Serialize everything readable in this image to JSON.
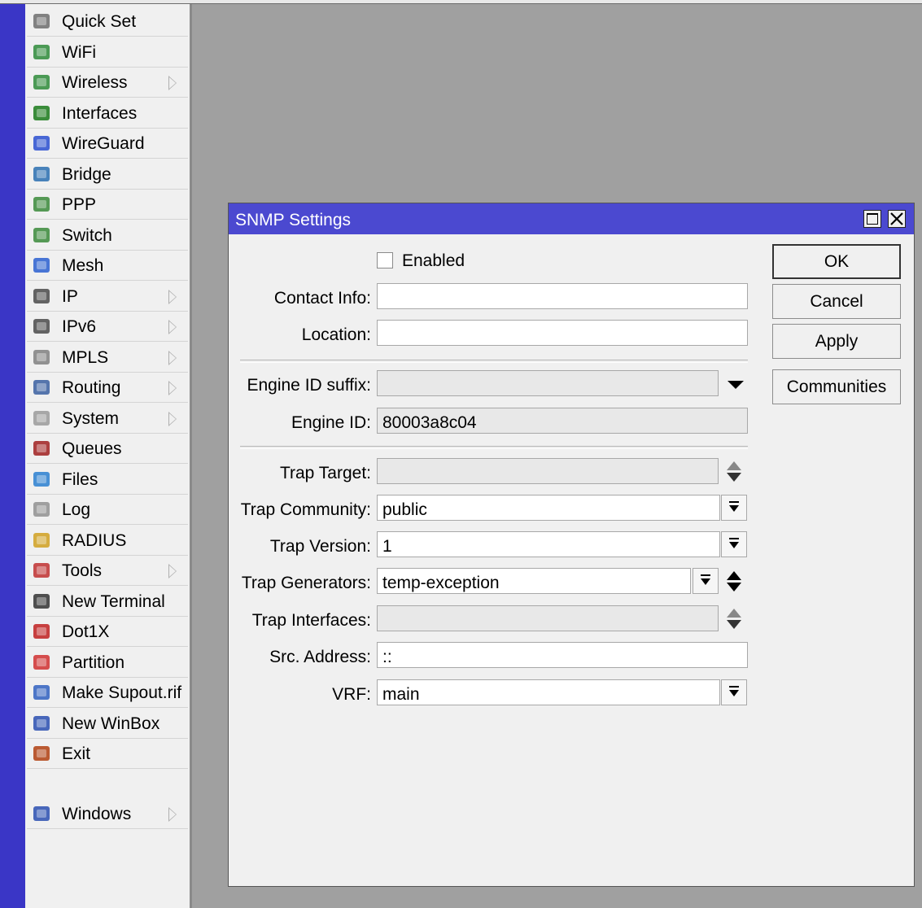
{
  "sidebar": {
    "items": [
      {
        "label": "Quick Set",
        "icon": "quick-set-icon",
        "submenu": false
      },
      {
        "label": "WiFi",
        "icon": "wifi-icon",
        "submenu": false
      },
      {
        "label": "Wireless",
        "icon": "wireless-icon",
        "submenu": true
      },
      {
        "label": "Interfaces",
        "icon": "interfaces-icon",
        "submenu": false
      },
      {
        "label": "WireGuard",
        "icon": "wireguard-icon",
        "submenu": false
      },
      {
        "label": "Bridge",
        "icon": "bridge-icon",
        "submenu": false
      },
      {
        "label": "PPP",
        "icon": "ppp-icon",
        "submenu": false
      },
      {
        "label": "Switch",
        "icon": "switch-icon",
        "submenu": false
      },
      {
        "label": "Mesh",
        "icon": "mesh-icon",
        "submenu": false
      },
      {
        "label": "IP",
        "icon": "ip-icon",
        "submenu": true
      },
      {
        "label": "IPv6",
        "icon": "ipv6-icon",
        "submenu": true
      },
      {
        "label": "MPLS",
        "icon": "mpls-icon",
        "submenu": true
      },
      {
        "label": "Routing",
        "icon": "routing-icon",
        "submenu": true
      },
      {
        "label": "System",
        "icon": "system-icon",
        "submenu": true
      },
      {
        "label": "Queues",
        "icon": "queues-icon",
        "submenu": false
      },
      {
        "label": "Files",
        "icon": "files-icon",
        "submenu": false
      },
      {
        "label": "Log",
        "icon": "log-icon",
        "submenu": false
      },
      {
        "label": "RADIUS",
        "icon": "radius-icon",
        "submenu": false
      },
      {
        "label": "Tools",
        "icon": "tools-icon",
        "submenu": true
      },
      {
        "label": "New Terminal",
        "icon": "terminal-icon",
        "submenu": false
      },
      {
        "label": "Dot1X",
        "icon": "dot1x-icon",
        "submenu": false
      },
      {
        "label": "Partition",
        "icon": "partition-icon",
        "submenu": false
      },
      {
        "label": "Make Supout.rif",
        "icon": "supout-icon",
        "submenu": false
      },
      {
        "label": "New WinBox",
        "icon": "winbox-icon",
        "submenu": false
      },
      {
        "label": "Exit",
        "icon": "exit-icon",
        "submenu": false
      }
    ],
    "windows": {
      "label": "Windows",
      "icon": "windows-icon",
      "submenu": true
    }
  },
  "dialog": {
    "title": "SNMP Settings",
    "enabled_label": "Enabled",
    "enabled_checked": false,
    "contact_info": {
      "label": "Contact Info:",
      "value": ""
    },
    "location": {
      "label": "Location:",
      "value": ""
    },
    "engine_id_suffix": {
      "label": "Engine ID suffix:",
      "value": ""
    },
    "engine_id": {
      "label": "Engine ID:",
      "value": "80003a8c04"
    },
    "trap_target": {
      "label": "Trap Target:",
      "value": ""
    },
    "trap_community": {
      "label": "Trap Community:",
      "value": "public"
    },
    "trap_version": {
      "label": "Trap Version:",
      "value": "1"
    },
    "trap_generators": {
      "label": "Trap Generators:",
      "value": "temp-exception"
    },
    "trap_interfaces": {
      "label": "Trap Interfaces:",
      "value": ""
    },
    "src_address": {
      "label": "Src. Address:",
      "value": "::"
    },
    "vrf": {
      "label": "VRF:",
      "value": "main"
    },
    "buttons": {
      "ok": "OK",
      "cancel": "Cancel",
      "apply": "Apply",
      "communities": "Communities"
    }
  },
  "colors": {
    "title_bar": "#4b49d0",
    "left_bar": "#3a36c6",
    "desktop": "#a0a0a0",
    "panel": "#f0f0f0"
  }
}
